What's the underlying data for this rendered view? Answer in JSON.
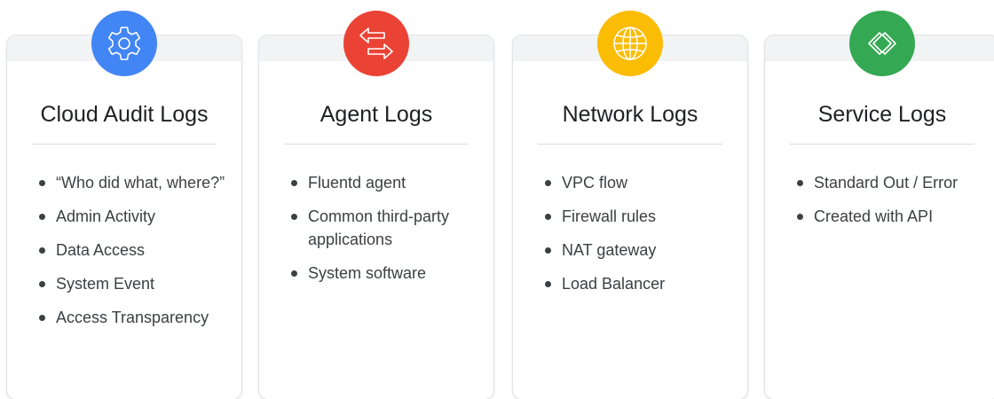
{
  "cards": [
    {
      "title": "Cloud Audit Logs",
      "icon": "gear-icon",
      "color": "#4285f4",
      "items": [
        "“Who did what, where?”",
        "Admin Activity",
        "Data Access",
        "System Event",
        "Access Transparency"
      ]
    },
    {
      "title": "Agent Logs",
      "icon": "transfer-arrows-icon",
      "color": "#ea4335",
      "items": [
        "Fluentd agent",
        "Common third-party applications",
        "System software"
      ]
    },
    {
      "title": "Network Logs",
      "icon": "globe-icon",
      "color": "#fbbc04",
      "items": [
        "VPC flow",
        "Firewall rules",
        "NAT gateway",
        "Load Balancer"
      ]
    },
    {
      "title": "Service Logs",
      "icon": "code-brackets-icon",
      "color": "#34a853",
      "items": [
        "Standard Out / Error",
        "Created with API"
      ]
    }
  ]
}
